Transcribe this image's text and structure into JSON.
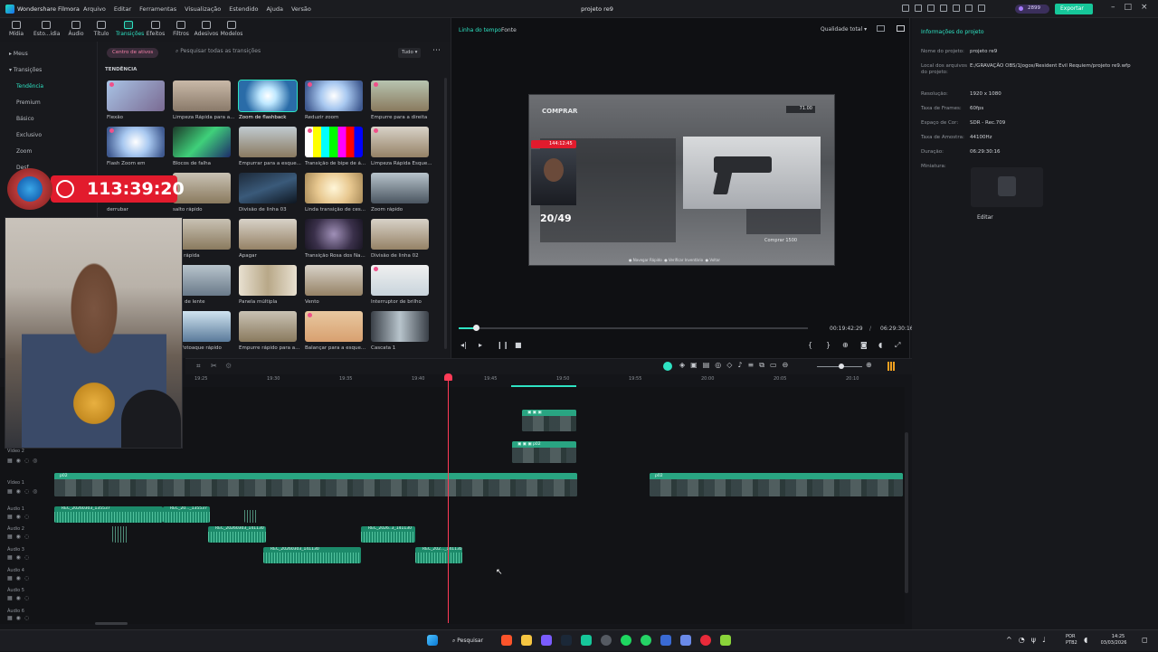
{
  "titlebar": {
    "app_name": "Wondershare Filmora",
    "menus": [
      "Arquivo",
      "Editar",
      "Ferramentas",
      "Visualização",
      "Estendido",
      "Ajuda",
      "Versão"
    ],
    "project_title": "projeto re9",
    "credits": "2899",
    "export_label": "Exportar"
  },
  "media_tabs": [
    {
      "label": "Mídia"
    },
    {
      "label": "Esto...idia"
    },
    {
      "label": "Áudio"
    },
    {
      "label": "Título"
    },
    {
      "label": "Transições"
    },
    {
      "label": "Efeitos"
    },
    {
      "label": "Filtros"
    },
    {
      "label": "Adesivos"
    },
    {
      "label": "Modelos"
    }
  ],
  "left_nav": {
    "items": [
      "Meus",
      "Transições",
      "Tendência",
      "Premium",
      "Básico",
      "Exclusivo",
      "Zoom",
      "Desf"
    ]
  },
  "transitions": {
    "center_button": "Centro de ativos",
    "search_placeholder": "Pesquisar todas as transições",
    "filter_label": "Tudo",
    "section_title": "TENDÊNCIA",
    "tiles": [
      {
        "label": "Flexão"
      },
      {
        "label": "Limpeza Rápida para a..."
      },
      {
        "label": "Zoom de flashback"
      },
      {
        "label": "Reduzir zoom"
      },
      {
        "label": "Empurre para a direita"
      },
      {
        "label": "Flash Zoom em"
      },
      {
        "label": "Blocos de falha"
      },
      {
        "label": "Empurrar para a esque..."
      },
      {
        "label": "Transição de bipe de á..."
      },
      {
        "label": "Limpeza Rápida Esque..."
      },
      {
        "label": "derrubar"
      },
      {
        "label": "salto rápido"
      },
      {
        "label": "Divisão de linha 03"
      },
      {
        "label": "Linda transição de ces..."
      },
      {
        "label": "Zoom rápido"
      },
      {
        "label": "o rápida"
      },
      {
        "label": "Apagar"
      },
      {
        "label": "Transição Rosa dos Na..."
      },
      {
        "label": "Divisão de linha 02"
      },
      {
        "label": "de lente"
      },
      {
        "label": "Panela múltipla"
      },
      {
        "label": "Vento"
      },
      {
        "label": "Interruptor de brilho"
      },
      {
        "label": "Fotoaque rápido"
      },
      {
        "label": "Empurre rápido para a..."
      },
      {
        "label": "Balançar para a esque..."
      },
      {
        "label": "Cascata 1"
      }
    ]
  },
  "preview": {
    "tab_timeline": "Linha do tempo",
    "tab_source": "Fonte",
    "quality": "Qualidade total",
    "current_time": "00:19:42:29",
    "separator": "/",
    "total_time": "06:29:30:16",
    "progress_fraction": 0.05,
    "game_frame": {
      "shop_title": "COMPRAR",
      "money": "71.00",
      "counter": "20/49",
      "timer_small": "144:12:45",
      "buy_label": "Comprar",
      "buy_price": "1500",
      "hint_1": "Navegar Rápido",
      "hint_2": "Verificar Inventário",
      "hint_3": "Voltar"
    }
  },
  "project_info": {
    "title": "Informações do projeto",
    "fields": [
      {
        "label": "Nome do projeto:",
        "value": "projeto re9"
      },
      {
        "label": "Local dos arquivos do projeto:",
        "value": "E:/GRAVAÇÃO OBS/1Jogos/Resident Evil Requiem/projeto re9.wfp"
      },
      {
        "label": "Resolução:",
        "value": "1920 x 1080"
      },
      {
        "label": "Taxa de Frames:",
        "value": "60fps"
      },
      {
        "label": "Espaço de Cor:",
        "value": "SDR - Rec.709"
      },
      {
        "label": "Taxa de Amostra:",
        "value": "44100Hz"
      },
      {
        "label": "Duração:",
        "value": "06:29:30:16"
      },
      {
        "label": "Miniatura:",
        "value": ""
      }
    ],
    "edit_label": "Editar"
  },
  "timeline": {
    "ruler_ticks": [
      "19:25",
      "19:30",
      "19:35",
      "19:40",
      "19:45",
      "19:50",
      "19:55",
      "20:00",
      "20:05",
      "20:10"
    ],
    "tracks": [
      {
        "label": "Vídeo 2"
      },
      {
        "label": "Vídeo 1"
      },
      {
        "label": "Áudio 1"
      },
      {
        "label": "Áudio 2"
      },
      {
        "label": "Áudio 3"
      },
      {
        "label": "Áudio 4"
      },
      {
        "label": "Áudio 5"
      },
      {
        "label": "Áudio 6"
      }
    ],
    "video_clip_label": "p02",
    "audio_clips": [
      {
        "label": "REC_20260303_135537"
      },
      {
        "label": "REC_20..._135537"
      },
      {
        "label": "REC_20260303_141130"
      },
      {
        "label": "REC_2026..3_141130"
      },
      {
        "label": "REC_20260303_141130"
      },
      {
        "label": "REC_202..._141130"
      }
    ]
  },
  "overlay": {
    "timer": "113:39:20"
  },
  "taskbar": {
    "search": "Pesquisar",
    "lang_1": "POR",
    "lang_2": "PTB2",
    "time": "14:25",
    "date": "03/03/2026"
  },
  "colors": {
    "accent": "#2ee3c3",
    "clip_green": "#1f8f72",
    "playhead": "#ff3b57",
    "timer_red": "#e21b2d"
  }
}
